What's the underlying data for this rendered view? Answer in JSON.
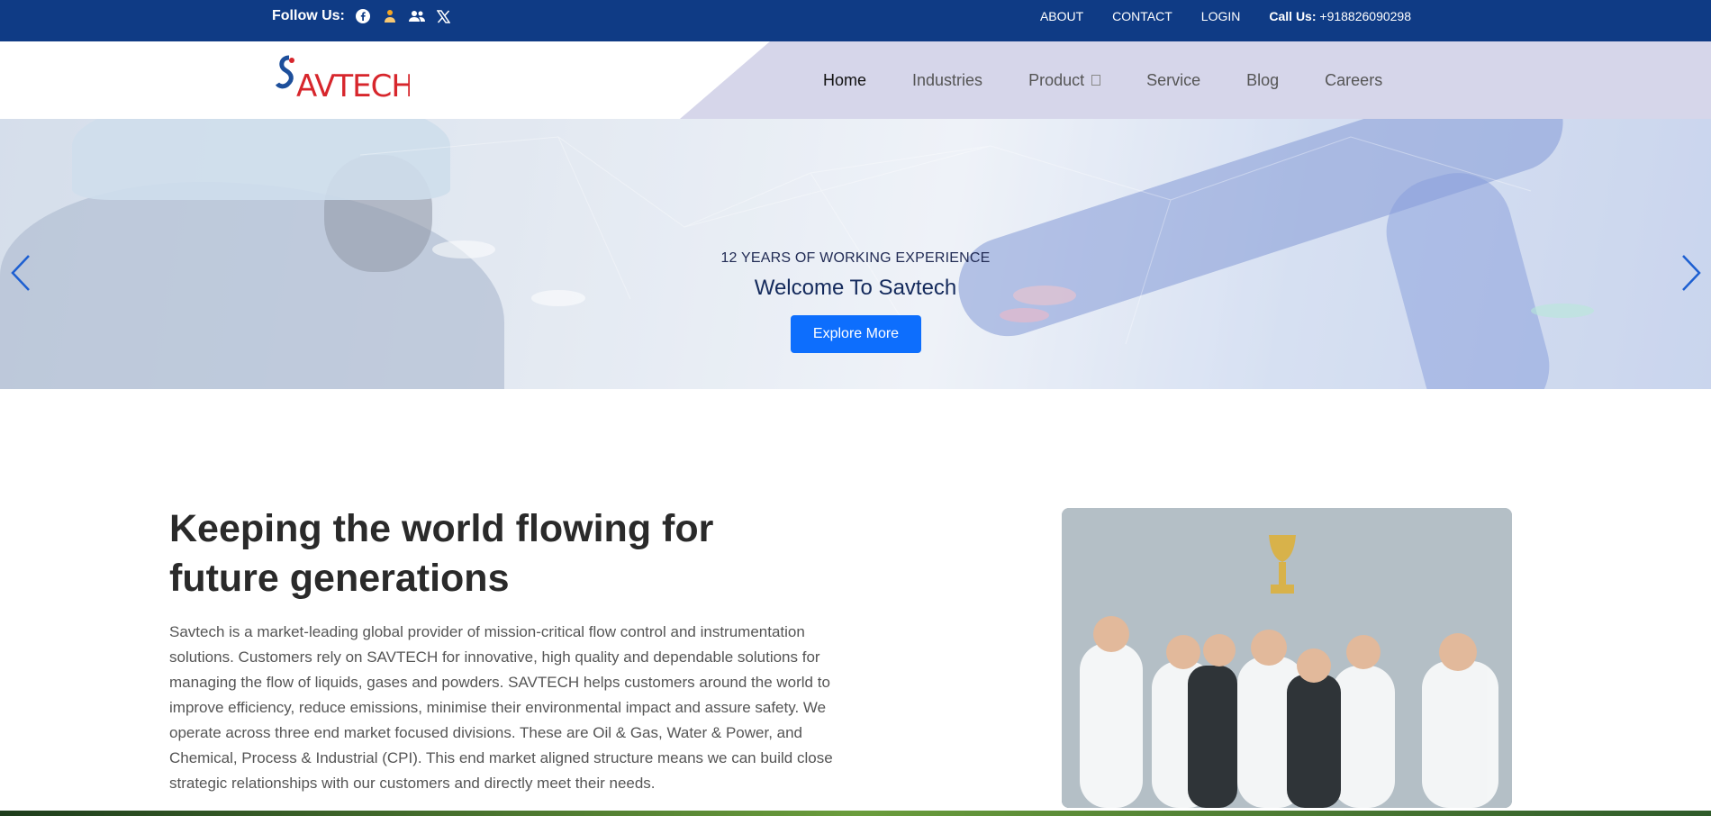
{
  "topbar": {
    "follow_label": "Follow Us:",
    "social_icons": [
      "facebook-icon",
      "person-icon",
      "users-icon",
      "x-icon"
    ],
    "links": [
      "ABOUT",
      "CONTACT",
      "LOGIN"
    ],
    "call_label": "Call Us:",
    "call_number": "+918826090298"
  },
  "header": {
    "logo_text": "SAVTECH",
    "nav": {
      "home": "Home",
      "industries": "Industries",
      "product": "Product",
      "service": "Service",
      "blog": "Blog",
      "careers": "Careers"
    }
  },
  "hero": {
    "subtitle": "12 YEARS OF WORKING EXPERIENCE",
    "title": "Welcome To Savtech",
    "button": "Explore More"
  },
  "about": {
    "title": "Keeping the world flowing for future generations",
    "text": "Savtech is a market-leading global provider of mission-critical flow control and instrumentation solutions. Customers rely on SAVTECH for innovative, high quality and dependable solutions for managing the flow of liquids, gases and powders. SAVTECH helps customers around the world to improve efficiency, reduce emissions, minimise their environmental impact and assure safety. We operate across three end market focused divisions. These are Oil & Gas, Water & Power, and Chemical, Process & Industrial (CPI). This end market aligned structure means we can build close strategic relationships with our customers and directly meet their needs."
  },
  "colors": {
    "topbar": "#0f3b85",
    "nav_bg": "#d6d6ea",
    "button": "#0d6efd",
    "logo_red": "#d7262c",
    "logo_blue": "#1d4f9b"
  }
}
